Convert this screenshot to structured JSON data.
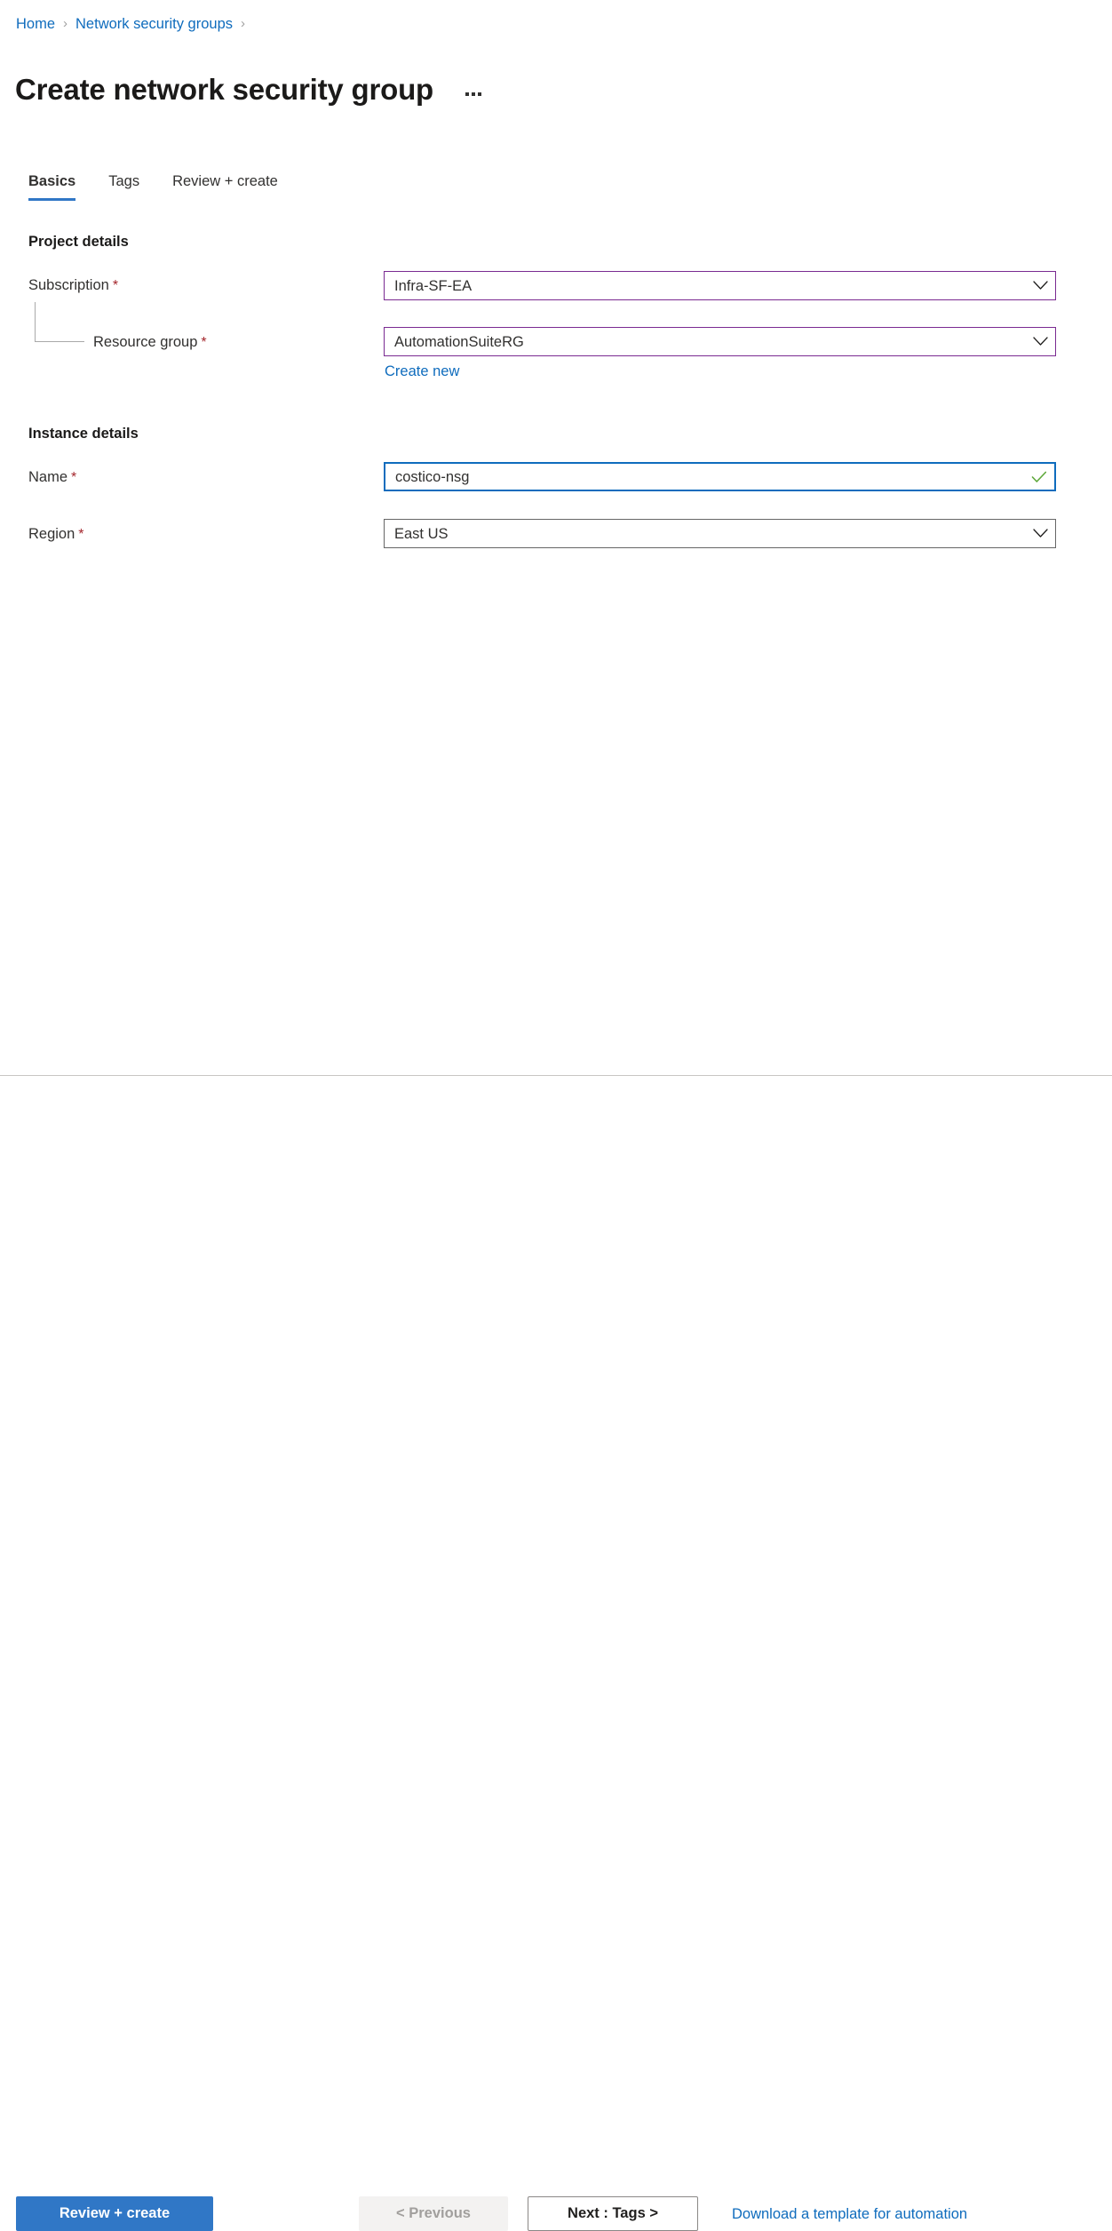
{
  "breadcrumb": {
    "items": [
      {
        "label": "Home"
      },
      {
        "label": "Network security groups"
      }
    ],
    "separator": "›"
  },
  "header": {
    "title": "Create network security group",
    "more_menu_icon": "ellipsis-icon"
  },
  "tabs": [
    {
      "label": "Basics",
      "active": true
    },
    {
      "label": "Tags",
      "active": false
    },
    {
      "label": "Review + create",
      "active": false
    }
  ],
  "sections": {
    "project_details": {
      "heading": "Project details",
      "subscription": {
        "label": "Subscription",
        "required_marker": "*",
        "value": "Infra-SF-EA",
        "icon": "chevron-down-icon"
      },
      "resource_group": {
        "label": "Resource group",
        "required_marker": "*",
        "value": "AutomationSuiteRG",
        "icon": "chevron-down-icon",
        "create_new_label": "Create new"
      }
    },
    "instance_details": {
      "heading": "Instance details",
      "name": {
        "label": "Name",
        "required_marker": "*",
        "value": "costico-nsg",
        "icon": "checkmark-icon"
      },
      "region": {
        "label": "Region",
        "required_marker": "*",
        "value": "East US",
        "icon": "chevron-down-icon"
      }
    }
  },
  "footer": {
    "review_create_label": "Review + create",
    "previous_label": "< Previous",
    "next_label": "Next : Tags >",
    "download_template_label": "Download a template for automation"
  },
  "colors": {
    "accent_blue": "#0f6cbd",
    "primary_button": "#3077c6",
    "required_red": "#a4262c",
    "selected_border_violet": "#7a2a91",
    "focus_border_blue": "#0f6cbd",
    "valid_check_green": "#5ea83a",
    "divider_gray": "#c8c6c4"
  }
}
